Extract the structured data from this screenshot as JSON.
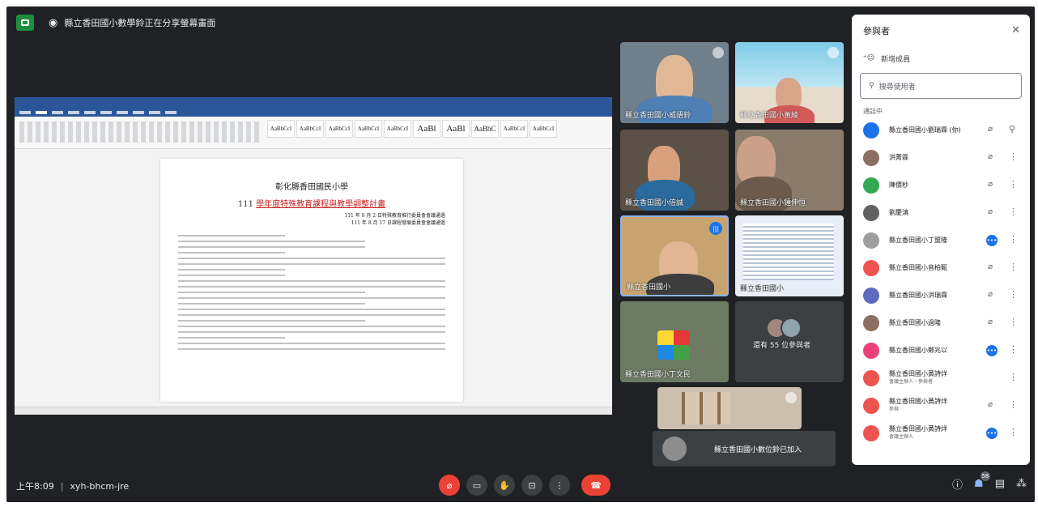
{
  "topbar": {
    "presenting_text": "縣立香田國小數學鈴正在分享螢幕畫面"
  },
  "document": {
    "title": "彰化縣香田國民小學",
    "subtitle_year": "111",
    "subtitle": "學年度特殊教育課程與教學調整計畫",
    "date_line1": "111 年 8 月 2 日特殊教育推行委員會會議通過",
    "date_line2": "111 年 8 月 17 日課程發展委員會會議通過"
  },
  "tiles": [
    {
      "name": "縣立香田國小威語鈴"
    },
    {
      "name": "縣立香田國小黃綾"
    },
    {
      "name": "縣立香田國小倍誠"
    },
    {
      "name": "縣立香田國小鍾伸恒"
    },
    {
      "name": "縣立香田國小"
    },
    {
      "name": "縣立香田國小"
    },
    {
      "name": "縣立香田國小丁文民"
    },
    {
      "name": "還有 55 位參與者"
    }
  ],
  "join_toast": {
    "text": "縣立香田國小數位鈴已加入"
  },
  "bottombar": {
    "time": "上午8:09",
    "meeting_code": "xyh-bhcm-jre",
    "participant_count": "58"
  },
  "panel": {
    "title": "參與者",
    "add_people": "新增成員",
    "search_placeholder": "搜尋使用者",
    "section_label": "通話中",
    "participants": [
      {
        "name": "縣立香田國小劉瑞霖 (你)",
        "sub": "",
        "status": "muted",
        "color": "#1a73e8"
      },
      {
        "name": "洪菁霖",
        "sub": "",
        "status": "muted",
        "color": "#8d6e63"
      },
      {
        "name": "陳價秒",
        "sub": "",
        "status": "muted",
        "color": "#34a853"
      },
      {
        "name": "劉慶鴻",
        "sub": "",
        "status": "muted",
        "color": "#616161"
      },
      {
        "name": "縣立香田國小丁盟隆",
        "sub": "",
        "status": "talking",
        "color": "#9e9e9e"
      },
      {
        "name": "縣立香田國小音柏甄",
        "sub": "",
        "status": "muted",
        "color": "#ef5350"
      },
      {
        "name": "縣立香田國小洪瑞霖",
        "sub": "",
        "status": "muted",
        "color": "#5c6bc0"
      },
      {
        "name": "縣立香田國小過隆",
        "sub": "",
        "status": "muted",
        "color": "#8d6e63"
      },
      {
        "name": "縣立香田國小鄭兆以",
        "sub": "",
        "status": "talking",
        "color": "#ec407a"
      },
      {
        "name": "縣立香田國小黃詩烊",
        "sub": "會議主辦人・參與者",
        "status": "none",
        "color": "#ef5350"
      },
      {
        "name": "縣立香田國小黃詩烊",
        "sub": "參與",
        "status": "muted",
        "color": "#ef5350"
      },
      {
        "name": "縣立香田國小黃詩烊",
        "sub": "會議主辦人",
        "status": "talking",
        "color": "#ef5350"
      }
    ]
  }
}
